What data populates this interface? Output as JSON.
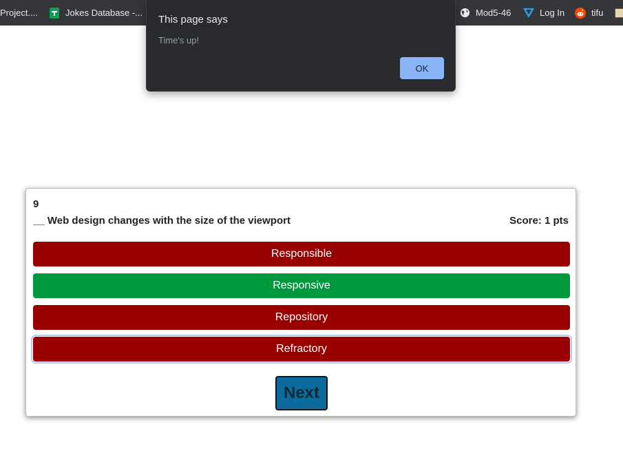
{
  "bookmarks": [
    {
      "label": "Project....",
      "icon": "none"
    },
    {
      "label": "Jokes Database -...",
      "icon": "google-sheets-icon",
      "color": "#0f9d58"
    },
    {
      "label": "Mod5-46",
      "icon": "globe-icon"
    },
    {
      "label": "Log In",
      "icon": "triangle-logo-icon",
      "color": "#2f9ce6"
    },
    {
      "label": "tifu",
      "icon": "reddit-icon",
      "color": "#ff4500"
    }
  ],
  "dialog": {
    "title": "This page says",
    "message": "Time's up!",
    "ok_label": "OK"
  },
  "quiz": {
    "question_number": "9",
    "question": "__ Web design changes with the size of the viewport",
    "score": "Score: 1 pts",
    "answers": [
      {
        "label": "Responsible",
        "color": "#990000",
        "state": "wrong"
      },
      {
        "label": "Responsive",
        "color": "#009a3e",
        "state": "correct"
      },
      {
        "label": "Repository",
        "color": "#990000",
        "state": "wrong"
      },
      {
        "label": "Refractory",
        "color": "#990000",
        "state": "wrong",
        "focused": true
      }
    ],
    "next_label": "Next"
  }
}
